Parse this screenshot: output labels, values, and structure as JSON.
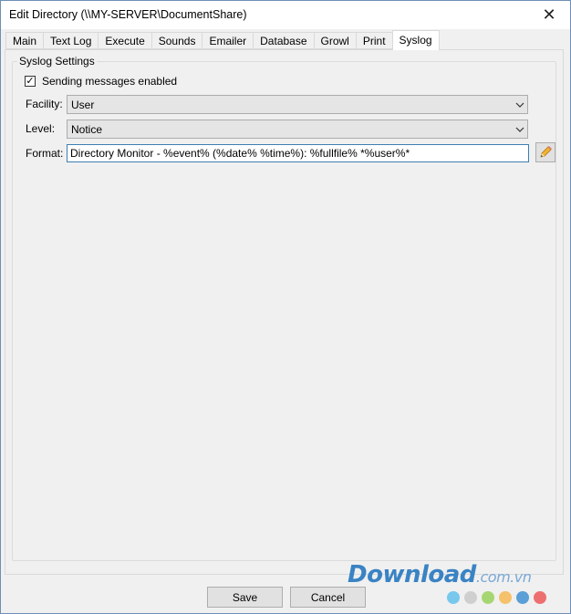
{
  "window": {
    "title": "Edit Directory (\\\\MY-SERVER\\DocumentShare)"
  },
  "tabs": [
    {
      "label": "Main"
    },
    {
      "label": "Text Log"
    },
    {
      "label": "Execute"
    },
    {
      "label": "Sounds"
    },
    {
      "label": "Emailer"
    },
    {
      "label": "Database"
    },
    {
      "label": "Growl"
    },
    {
      "label": "Print"
    },
    {
      "label": "Syslog"
    }
  ],
  "active_tab": "Syslog",
  "syslog": {
    "group_title": "Syslog Settings",
    "enabled_label": "Sending messages enabled",
    "enabled_checked": true,
    "facility_label": "Facility:",
    "facility_value": "User",
    "level_label": "Level:",
    "level_value": "Notice",
    "format_label": "Format:",
    "format_value": "Directory Monitor - %event% (%date% %time%): %fullfile% *%user%*"
  },
  "buttons": {
    "save": "Save",
    "cancel": "Cancel"
  },
  "watermark": {
    "brand": "Download",
    "suffix": ".com.vn"
  },
  "colors": {
    "accent": "#3c7fb1",
    "dots": [
      "#78c8ee",
      "#cfcfcf",
      "#a6d672",
      "#f5c16b",
      "#5b9fd6",
      "#ee6f6f"
    ]
  }
}
